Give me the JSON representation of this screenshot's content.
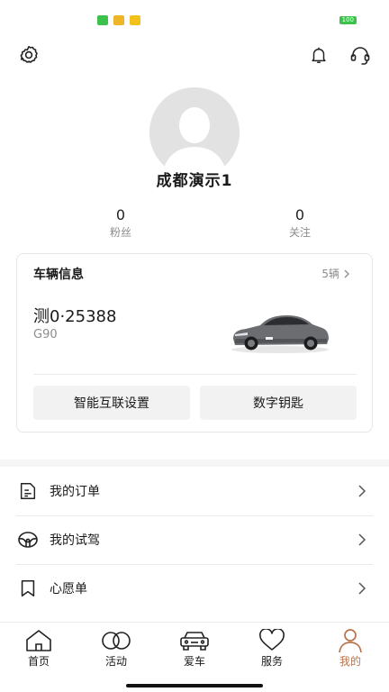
{
  "status_bar": {
    "battery": "100"
  },
  "header": {
    "settings_icon": "gear-icon",
    "notify_icon": "bell-icon",
    "support_icon": "headset-icon"
  },
  "profile": {
    "username": "成都演示1",
    "followers_count": "0",
    "followers_label": "粉丝",
    "following_count": "0",
    "following_label": "关注"
  },
  "vehicle_card": {
    "title": "车辆信息",
    "count_label": "5辆",
    "plate": "测0·25388",
    "model": "G90",
    "btn_smart": "智能互联设置",
    "btn_key": "数字钥匙"
  },
  "menu": {
    "items": [
      {
        "label": "我的订单",
        "icon": "order-icon"
      },
      {
        "label": "我的试驾",
        "icon": "steering-wheel-icon"
      },
      {
        "label": "心愿单",
        "icon": "bookmark-icon"
      }
    ]
  },
  "tabs": [
    {
      "label": "首页",
      "icon": "home-icon"
    },
    {
      "label": "活动",
      "icon": "rings-icon"
    },
    {
      "label": "爱车",
      "icon": "car-icon"
    },
    {
      "label": "服务",
      "icon": "heart-icon"
    },
    {
      "label": "我的",
      "icon": "user-icon",
      "active": true
    }
  ],
  "colors": {
    "accent": "#b8734f",
    "background": "#f5f5f5"
  }
}
